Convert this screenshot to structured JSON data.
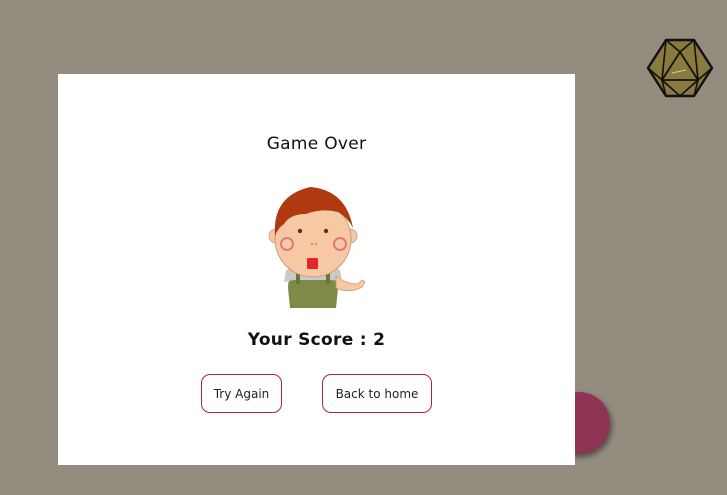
{
  "modal": {
    "title": "Game Over",
    "score_text": "Your Score : 2",
    "try_again_label": "Try Again",
    "home_label": "Back to home"
  },
  "colors": {
    "background": "#958c80",
    "button_border": "#b3282c",
    "ball": "#8e3556",
    "dice": "#8b7a3e"
  },
  "icons": {
    "dice": "d20-dice-icon",
    "character": "boy-character"
  }
}
